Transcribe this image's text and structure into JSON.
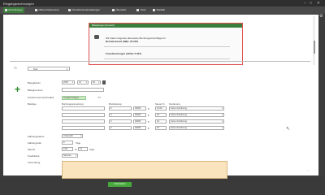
{
  "window": {
    "title": "Eingangsrechnungen"
  },
  "tabs": [
    {
      "label": "Einzelbelege",
      "active": true
    },
    {
      "label": "Offene Dokumente",
      "active": false
    },
    {
      "label": "Periodische Einstellungen",
      "active": false
    },
    {
      "label": "Übersicht",
      "active": false
    },
    {
      "label": "Tools",
      "active": false
    },
    {
      "label": "Statistik",
      "active": false
    }
  ],
  "search": {
    "value": "Alle Datensätze"
  },
  "popup": {
    "header": "Belastungen (Amount)",
    "line1": "Wir haben folgende alternative Buchungsvorschläge für",
    "line2": "Betriebsbezirf (49E): 25.00%",
    "line3": "Fremdleistungen (3100): 5.00%"
  },
  "scope": {
    "value": "Test"
  },
  "form": {
    "belegdatum_label": "Belegdatum",
    "belegdatum_year": "2018",
    "belegdatum_month": "01",
    "belegdatum_day": "26",
    "belegnummer_label": "Belegnummer",
    "kreditor_label": "Kundennummer/Kreditor",
    "kreditor_value": "Kreditor Anlegen",
    "betraege_label": "Beträge",
    "col_buchung": "Buchungsanmerkung",
    "col_brutto": "Bruttobetrag",
    "col_mwst": "Steuer %",
    "col_kont": "Kontierung",
    "rows": [
      {
        "amount_a": "0",
        "amount_b": "00000",
        "currency": "€",
        "mwst": "21.00",
        "kont": "Keine Zuordnung"
      },
      {
        "amount_a": "0",
        "amount_b": "00000",
        "currency": "€",
        "mwst": "19",
        "kont": "Keine Zuordnung"
      },
      {
        "amount_a": "0",
        "amount_b": "00000",
        "currency": "€",
        "mwst": "19",
        "kont": "Keine Zuordnung"
      },
      {
        "amount_a": "0",
        "amount_b": "00000",
        "currency": "€",
        "mwst": "19",
        "kont": "Keine Zuordnung"
      }
    ],
    "zahlungsstatus_label": "Zahlungsstatus",
    "zahlungsstatus_value": "Unbezahlt",
    "zahlungsziel_label": "Zahlungsziel",
    "zahlungsziel_value": "0",
    "zahlungsziel_unit": "Tage",
    "skonto_label": "Skonto",
    "skonto_value": "0.00",
    "skonto_pct": "%",
    "skonto_days": "14",
    "skonto_unit": "Tage",
    "kasse_label": "Kreditkarte",
    "kasse_value": "Nehmen",
    "anmerkung_label": "Anmerkung",
    "submit_label": "Erstellen"
  }
}
